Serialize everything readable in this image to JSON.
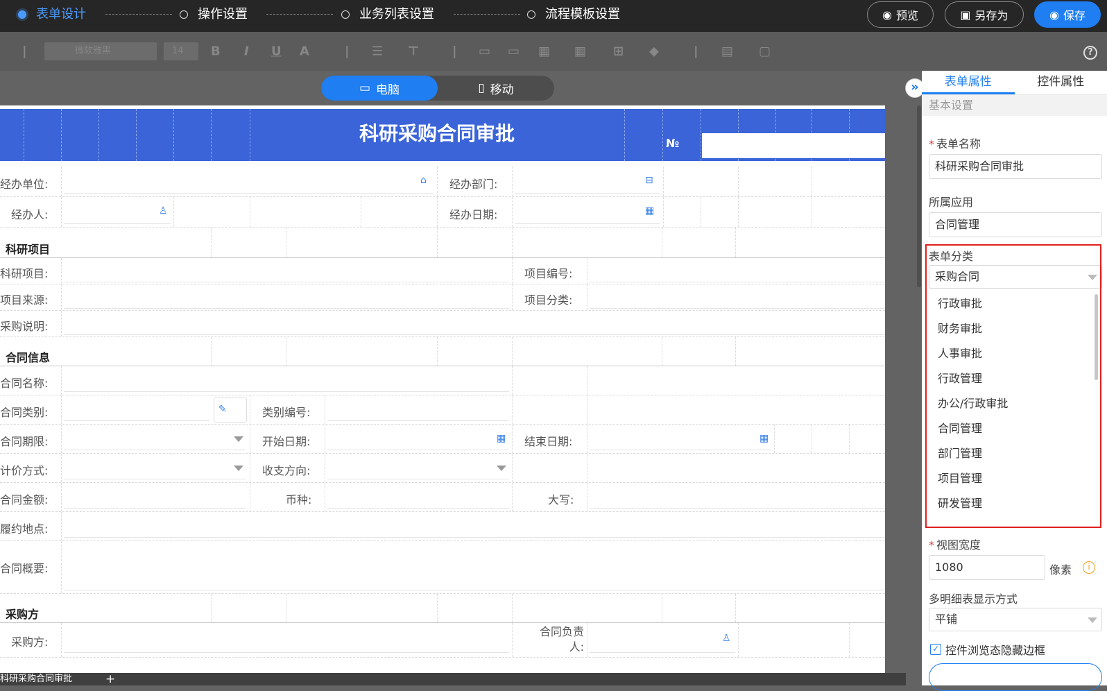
{
  "steps": [
    "表单设计",
    "操作设置",
    "业务列表设置",
    "流程模板设置"
  ],
  "top_buttons": {
    "preview": "预览",
    "save_as": "另存为",
    "save": "保存"
  },
  "toolbar": {
    "font": "微软雅黑",
    "size": "14",
    "bold": "B",
    "italic": "I",
    "underline": "U",
    "font_color": "A",
    "help": "?"
  },
  "device": {
    "pc": "电脑",
    "mobile": "移动"
  },
  "form": {
    "title": "科研采购合同审批",
    "no_label": "№",
    "labels": {
      "unit": "经办单位:",
      "dept": "经办部门:",
      "person": "经办人:",
      "date": "经办日期:",
      "project": "科研项目:",
      "project_no": "项目编号:",
      "source": "项目来源:",
      "category": "项目分类:",
      "desc": "采购说明:",
      "contract_name": "合同名称:",
      "contract_type": "合同类别:",
      "type_no": "类别编号:",
      "term": "合同期限:",
      "start": "开始日期:",
      "end": "结束日期:",
      "pricing": "计价方式:",
      "direction": "收支方向:",
      "amount": "合同金额:",
      "currency": "币种:",
      "capital": "大写:",
      "place": "履约地点:",
      "summary": "合同概要:",
      "buyer": "采购方:",
      "owner": "合同负责人:"
    },
    "sections": {
      "project": "科研项目",
      "contract": "合同信息",
      "buyer": "采购方"
    }
  },
  "bottom_tab": {
    "name": "科研采购合同审批",
    "add": "+"
  },
  "panel": {
    "tabs": [
      "表单属性",
      "控件属性"
    ],
    "section": "基本设置",
    "form_name_label": "表单名称",
    "form_name": "科研采购合同审批",
    "app_label": "所属应用",
    "app": "合同管理",
    "category_label": "表单分类",
    "category": "采购合同",
    "category_options": [
      "行政审批",
      "财务审批",
      "人事审批",
      "行政管理",
      "办公/行政审批",
      "合同管理",
      "部门管理",
      "项目管理",
      "研发管理"
    ],
    "view_width_label": "视图宽度",
    "view_width": "1080",
    "unit": "像素",
    "detail_label": "多明细表显示方式",
    "detail": "平铺",
    "hide_border": "控件浏览态隐藏边框",
    "collapse": "»"
  }
}
